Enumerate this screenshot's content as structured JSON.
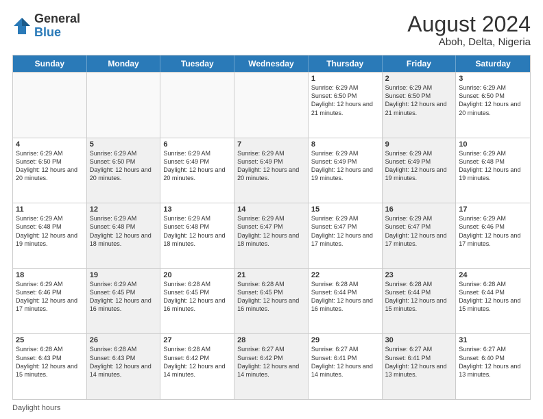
{
  "header": {
    "logo_general": "General",
    "logo_blue": "Blue",
    "month_year": "August 2024",
    "location": "Aboh, Delta, Nigeria"
  },
  "weekdays": [
    "Sunday",
    "Monday",
    "Tuesday",
    "Wednesday",
    "Thursday",
    "Friday",
    "Saturday"
  ],
  "footer": "Daylight hours",
  "rows": [
    [
      {
        "day": "",
        "empty": true
      },
      {
        "day": "",
        "empty": true
      },
      {
        "day": "",
        "empty": true
      },
      {
        "day": "",
        "empty": true
      },
      {
        "day": "1",
        "info": "Sunrise: 6:29 AM\nSunset: 6:50 PM\nDaylight: 12 hours\nand 21 minutes."
      },
      {
        "day": "2",
        "info": "Sunrise: 6:29 AM\nSunset: 6:50 PM\nDaylight: 12 hours\nand 21 minutes.",
        "shaded": true
      },
      {
        "day": "3",
        "info": "Sunrise: 6:29 AM\nSunset: 6:50 PM\nDaylight: 12 hours\nand 20 minutes."
      }
    ],
    [
      {
        "day": "4",
        "info": "Sunrise: 6:29 AM\nSunset: 6:50 PM\nDaylight: 12 hours\nand 20 minutes."
      },
      {
        "day": "5",
        "info": "Sunrise: 6:29 AM\nSunset: 6:50 PM\nDaylight: 12 hours\nand 20 minutes.",
        "shaded": true
      },
      {
        "day": "6",
        "info": "Sunrise: 6:29 AM\nSunset: 6:49 PM\nDaylight: 12 hours\nand 20 minutes."
      },
      {
        "day": "7",
        "info": "Sunrise: 6:29 AM\nSunset: 6:49 PM\nDaylight: 12 hours\nand 20 minutes.",
        "shaded": true
      },
      {
        "day": "8",
        "info": "Sunrise: 6:29 AM\nSunset: 6:49 PM\nDaylight: 12 hours\nand 19 minutes."
      },
      {
        "day": "9",
        "info": "Sunrise: 6:29 AM\nSunset: 6:49 PM\nDaylight: 12 hours\nand 19 minutes.",
        "shaded": true
      },
      {
        "day": "10",
        "info": "Sunrise: 6:29 AM\nSunset: 6:48 PM\nDaylight: 12 hours\nand 19 minutes."
      }
    ],
    [
      {
        "day": "11",
        "info": "Sunrise: 6:29 AM\nSunset: 6:48 PM\nDaylight: 12 hours\nand 19 minutes."
      },
      {
        "day": "12",
        "info": "Sunrise: 6:29 AM\nSunset: 6:48 PM\nDaylight: 12 hours\nand 18 minutes.",
        "shaded": true
      },
      {
        "day": "13",
        "info": "Sunrise: 6:29 AM\nSunset: 6:48 PM\nDaylight: 12 hours\nand 18 minutes."
      },
      {
        "day": "14",
        "info": "Sunrise: 6:29 AM\nSunset: 6:47 PM\nDaylight: 12 hours\nand 18 minutes.",
        "shaded": true
      },
      {
        "day": "15",
        "info": "Sunrise: 6:29 AM\nSunset: 6:47 PM\nDaylight: 12 hours\nand 17 minutes."
      },
      {
        "day": "16",
        "info": "Sunrise: 6:29 AM\nSunset: 6:47 PM\nDaylight: 12 hours\nand 17 minutes.",
        "shaded": true
      },
      {
        "day": "17",
        "info": "Sunrise: 6:29 AM\nSunset: 6:46 PM\nDaylight: 12 hours\nand 17 minutes."
      }
    ],
    [
      {
        "day": "18",
        "info": "Sunrise: 6:29 AM\nSunset: 6:46 PM\nDaylight: 12 hours\nand 17 minutes."
      },
      {
        "day": "19",
        "info": "Sunrise: 6:29 AM\nSunset: 6:45 PM\nDaylight: 12 hours\nand 16 minutes.",
        "shaded": true
      },
      {
        "day": "20",
        "info": "Sunrise: 6:28 AM\nSunset: 6:45 PM\nDaylight: 12 hours\nand 16 minutes."
      },
      {
        "day": "21",
        "info": "Sunrise: 6:28 AM\nSunset: 6:45 PM\nDaylight: 12 hours\nand 16 minutes.",
        "shaded": true
      },
      {
        "day": "22",
        "info": "Sunrise: 6:28 AM\nSunset: 6:44 PM\nDaylight: 12 hours\nand 16 minutes."
      },
      {
        "day": "23",
        "info": "Sunrise: 6:28 AM\nSunset: 6:44 PM\nDaylight: 12 hours\nand 15 minutes.",
        "shaded": true
      },
      {
        "day": "24",
        "info": "Sunrise: 6:28 AM\nSunset: 6:44 PM\nDaylight: 12 hours\nand 15 minutes."
      }
    ],
    [
      {
        "day": "25",
        "info": "Sunrise: 6:28 AM\nSunset: 6:43 PM\nDaylight: 12 hours\nand 15 minutes."
      },
      {
        "day": "26",
        "info": "Sunrise: 6:28 AM\nSunset: 6:43 PM\nDaylight: 12 hours\nand 14 minutes.",
        "shaded": true
      },
      {
        "day": "27",
        "info": "Sunrise: 6:28 AM\nSunset: 6:42 PM\nDaylight: 12 hours\nand 14 minutes."
      },
      {
        "day": "28",
        "info": "Sunrise: 6:27 AM\nSunset: 6:42 PM\nDaylight: 12 hours\nand 14 minutes.",
        "shaded": true
      },
      {
        "day": "29",
        "info": "Sunrise: 6:27 AM\nSunset: 6:41 PM\nDaylight: 12 hours\nand 14 minutes."
      },
      {
        "day": "30",
        "info": "Sunrise: 6:27 AM\nSunset: 6:41 PM\nDaylight: 12 hours\nand 13 minutes.",
        "shaded": true
      },
      {
        "day": "31",
        "info": "Sunrise: 6:27 AM\nSunset: 6:40 PM\nDaylight: 12 hours\nand 13 minutes."
      }
    ]
  ]
}
